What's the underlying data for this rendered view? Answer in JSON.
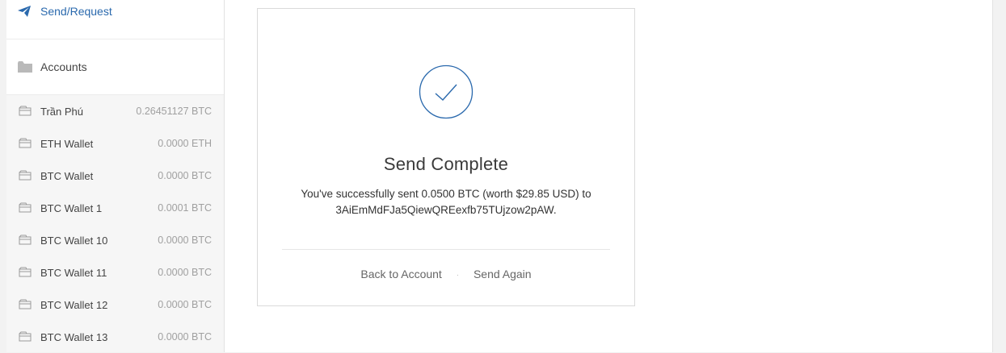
{
  "sidebar": {
    "send_request_label": "Send/Request",
    "accounts_label": "Accounts",
    "accounts": [
      {
        "name": "Trần Phú",
        "balance": "0.26451127 BTC"
      },
      {
        "name": "ETH Wallet",
        "balance": "0.0000 ETH"
      },
      {
        "name": "BTC Wallet",
        "balance": "0.0000 BTC"
      },
      {
        "name": "BTC Wallet 1",
        "balance": "0.0001 BTC"
      },
      {
        "name": "BTC Wallet 10",
        "balance": "0.0000 BTC"
      },
      {
        "name": "BTC Wallet 11",
        "balance": "0.0000 BTC"
      },
      {
        "name": "BTC Wallet 12",
        "balance": "0.0000 BTC"
      },
      {
        "name": "BTC Wallet 13",
        "balance": "0.0000 BTC"
      }
    ]
  },
  "confirmation": {
    "title": "Send Complete",
    "message_line1": "You've successfully sent 0.0500 BTC (worth $29.85 USD) to",
    "message_line2": "3AiEmMdFJa5QiewQREexfb75TUjzow2pAW.",
    "back_label": "Back to Account",
    "separator": "·",
    "send_again_label": "Send Again"
  },
  "icons": {
    "send": "paper-plane-icon",
    "accounts": "folder-icon",
    "account": "wallet-icon",
    "success": "checkmark-circle-icon"
  },
  "colors": {
    "accent": "#2a69ad",
    "muted": "#a0a0a0"
  }
}
